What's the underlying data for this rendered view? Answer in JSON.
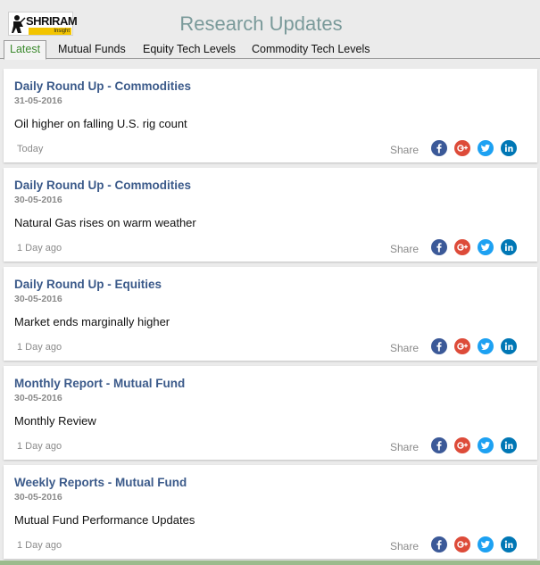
{
  "header": {
    "logo_text": "SHRIRAM",
    "logo_subtext": "Insight",
    "title": "Research Updates"
  },
  "tabs": [
    {
      "label": "Latest",
      "active": true
    },
    {
      "label": "Mutual Funds",
      "active": false
    },
    {
      "label": "Equity Tech Levels",
      "active": false
    },
    {
      "label": "Commodity Tech Levels",
      "active": false
    }
  ],
  "share_label": "Share",
  "colors": {
    "facebook": "#3b5998",
    "google_plus": "#dd4b39",
    "twitter": "#1da1f2",
    "linkedin": "#0077b5",
    "title_link": "#3b5a8a",
    "active_tab": "#3c8a2e"
  },
  "social_icons": [
    "facebook-icon",
    "google-plus-icon",
    "twitter-icon",
    "linkedin-icon"
  ],
  "feed": [
    {
      "title": "Daily Round Up - Commodities",
      "date": "31-05-2016",
      "summary": "Oil higher on falling U.S. rig count",
      "age": "Today"
    },
    {
      "title": "Daily Round Up - Commodities",
      "date": "30-05-2016",
      "summary": "Natural Gas rises on warm weather",
      "age": "1 Day ago"
    },
    {
      "title": "Daily Round Up - Equities",
      "date": "30-05-2016",
      "summary": "Market ends marginally higher",
      "age": "1 Day ago"
    },
    {
      "title": "Monthly Report - Mutual Fund",
      "date": "30-05-2016",
      "summary": "Monthly Review",
      "age": "1 Day ago"
    },
    {
      "title": "Weekly Reports - Mutual Fund",
      "date": "30-05-2016",
      "summary": "Mutual Fund Performance Updates",
      "age": "1 Day ago"
    }
  ]
}
